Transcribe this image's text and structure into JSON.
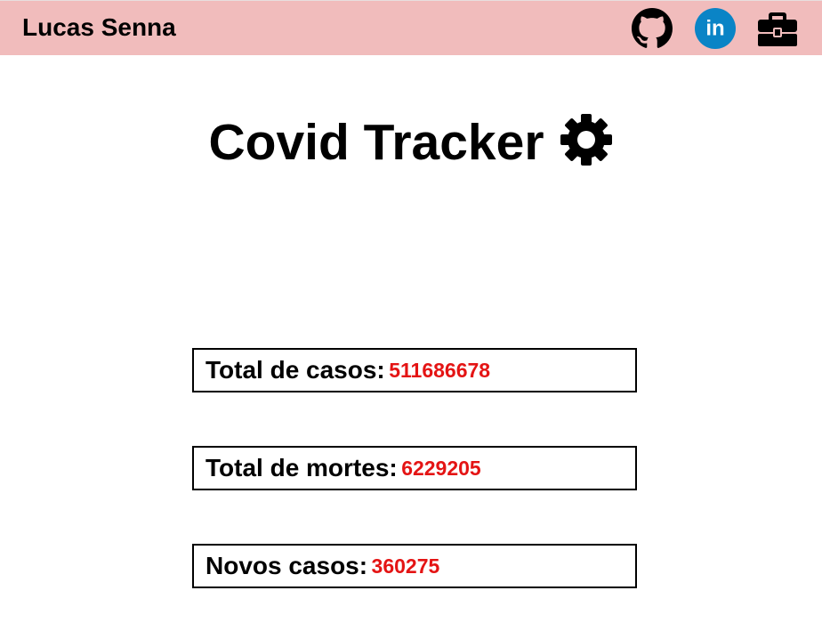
{
  "navbar": {
    "brand": "Lucas Senna",
    "icons": [
      "github-icon",
      "linkedin-icon",
      "briefcase-icon"
    ],
    "linkedin_text": "in",
    "background_color": "#f1bcbc",
    "linkedin_color": "#0a84c6"
  },
  "header": {
    "title": "Covid Tracker",
    "title_icon": "gear-icon"
  },
  "stats": {
    "total_cases": {
      "label": "Total de casos:",
      "value": "511686678"
    },
    "total_deaths": {
      "label": "Total de mortes:",
      "value": "6229205"
    },
    "new_cases": {
      "label": "Novos casos:",
      "value": "360275"
    }
  },
  "colors": {
    "value_red": "#e41414"
  }
}
